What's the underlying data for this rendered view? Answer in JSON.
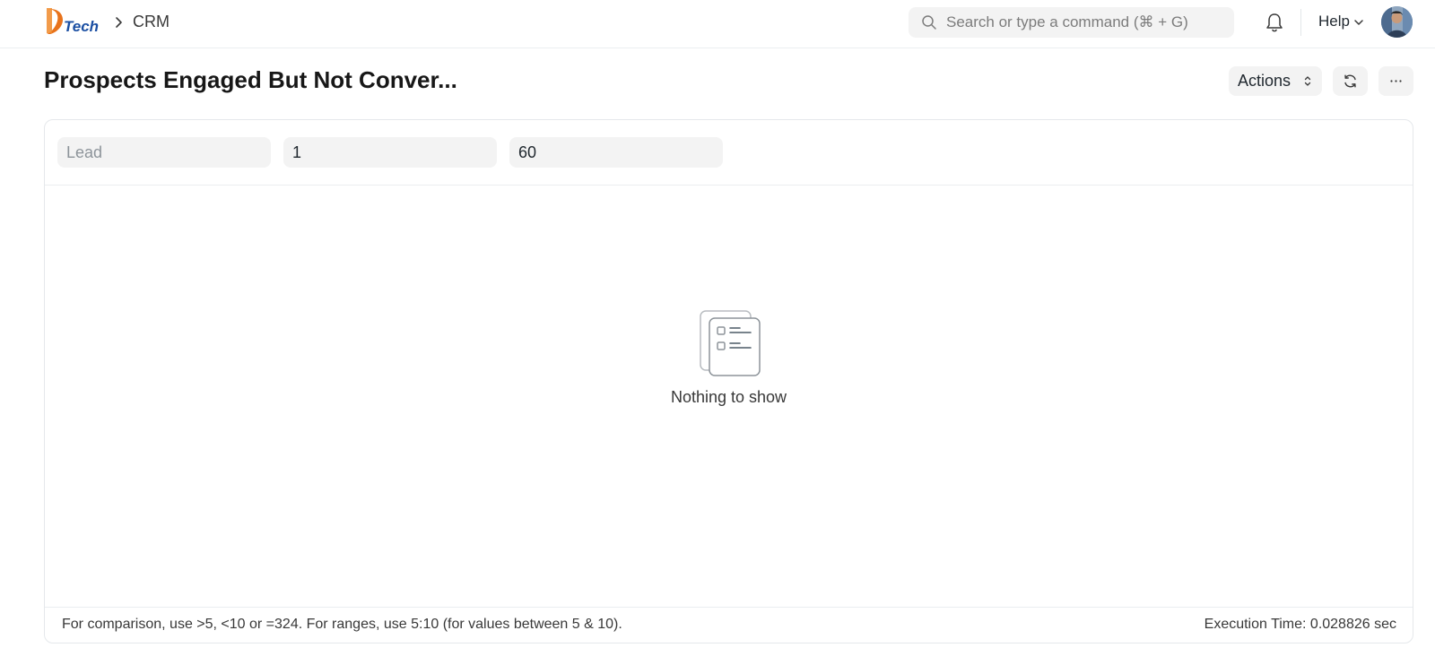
{
  "navbar": {
    "logo_alt": "DTech",
    "breadcrumb": [
      "CRM"
    ],
    "search_placeholder": "Search or type a command (⌘ + G)",
    "help_label": "Help"
  },
  "page": {
    "title": "Prospects Engaged But Not Conver...",
    "actions_label": "Actions"
  },
  "filters": [
    {
      "placeholder": "Lead",
      "value": ""
    },
    {
      "placeholder": "",
      "value": "1"
    },
    {
      "placeholder": "",
      "value": "60"
    }
  ],
  "report": {
    "empty_message": "Nothing to show",
    "footer_hint": "For comparison, use >5, <10 or =324. For ranges, use 5:10 (for values between 5 & 10).",
    "execution_time": "Execution Time: 0.028826 sec"
  },
  "colors": {
    "logo_orange": "#e8731c",
    "logo_blue": "#1b4fa3"
  }
}
